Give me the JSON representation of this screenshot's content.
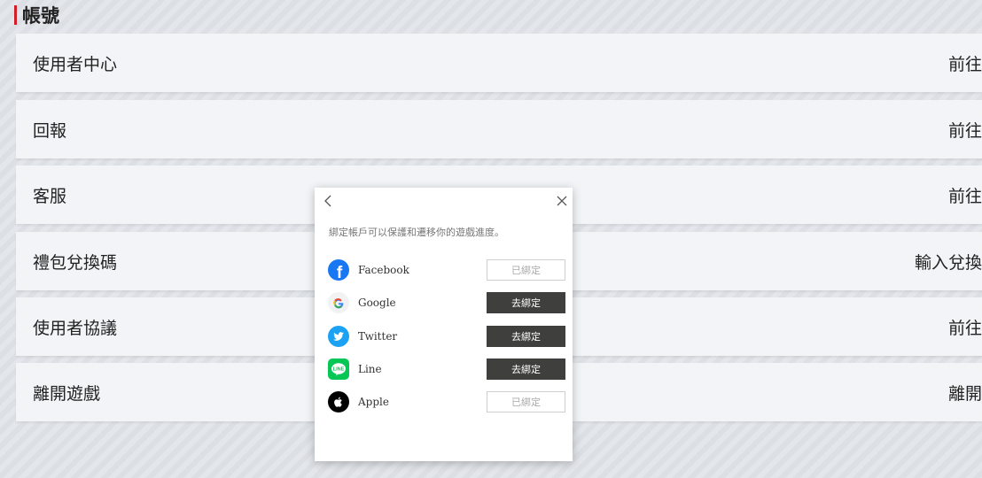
{
  "section": {
    "title": "帳號"
  },
  "menu": [
    {
      "label": "使用者中心",
      "action": "前往"
    },
    {
      "label": "回報",
      "action": "前往"
    },
    {
      "label": "客服",
      "action": "前往"
    },
    {
      "label": "禮包兌換碼",
      "action": "輸入兌換"
    },
    {
      "label": "使用者協議",
      "action": "前往"
    },
    {
      "label": "離開遊戲",
      "action": "離開"
    }
  ],
  "dialog": {
    "description": "綁定帳戶可以保護和遷移你的遊戲進度。",
    "providers": [
      {
        "name": "Facebook",
        "button": "已綁定",
        "state": "bound",
        "icon": "facebook-icon",
        "color": "#1877f2"
      },
      {
        "name": "Google",
        "button": "去綁定",
        "state": "unbound",
        "icon": "google-icon",
        "color": "#4285f4"
      },
      {
        "name": "Twitter",
        "button": "去綁定",
        "state": "unbound",
        "icon": "twitter-icon",
        "color": "#1da1f2"
      },
      {
        "name": "Line",
        "button": "去綁定",
        "state": "unbound",
        "icon": "line-icon",
        "color": "#06c755"
      },
      {
        "name": "Apple",
        "button": "已綁定",
        "state": "bound",
        "icon": "apple-icon",
        "color": "#000000"
      }
    ]
  }
}
